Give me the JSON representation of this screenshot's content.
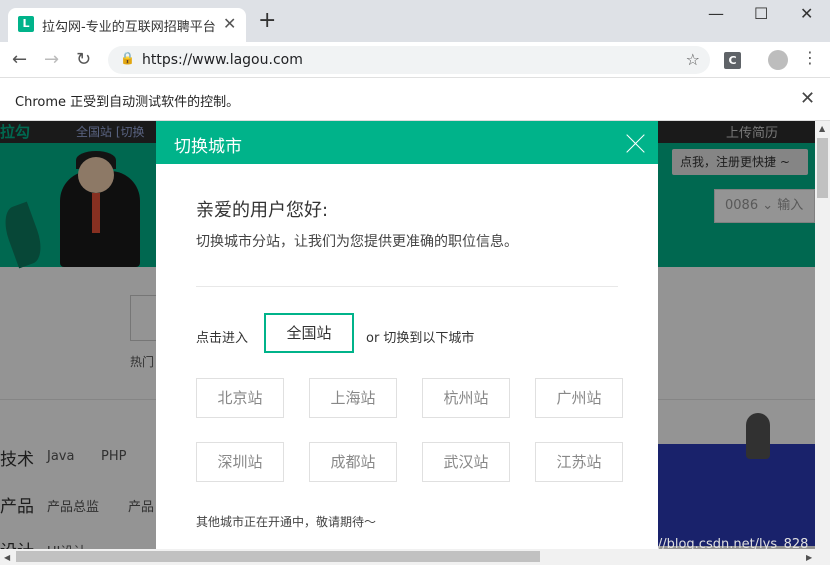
{
  "browser": {
    "tab_title": "拉勾网-专业的互联网招聘平台",
    "favicon_letter": "L",
    "tab_close": "✕",
    "new_tab": "+",
    "minimize": "—",
    "maximize": "☐",
    "close": "✕",
    "url": "https://www.lagou.com",
    "extension_letter": "C",
    "info_message": "Chrome 正受到自动测试软件的控制。",
    "info_close": "✕"
  },
  "background_page": {
    "logo": "拉勾",
    "nav": "全国站   [切换",
    "upload": "上传简历",
    "register_hint": "点我，注册更快捷 ~",
    "phone_prefix": "0086  ⌄  输入",
    "hot_label": "热门",
    "categories": [
      {
        "name": "技术",
        "items": [
          "Java",
          "PHP"
        ]
      },
      {
        "name": "产品",
        "items": [
          "产品总监",
          "产品"
        ]
      },
      {
        "name": "设计",
        "items": [
          "UI设计"
        ]
      }
    ],
    "watermark": "https://blog.csdn.net/lys_828"
  },
  "modal": {
    "title": "切换城市",
    "greeting": "亲爱的用户您好:",
    "subtext": "切换城市分站，让我们为您提供更准确的职位信息。",
    "enter_label": "点击进入",
    "nation_button": "全国站",
    "or_text": "or 切换到以下城市",
    "cities": [
      "北京站",
      "上海站",
      "杭州站",
      "广州站",
      "深圳站",
      "成都站",
      "武汉站",
      "江苏站"
    ],
    "footnote": "其他城市正在开通中，敬请期待～"
  },
  "colors": {
    "accent": "#00b38a",
    "overlay": "rgba(0,0,0,0.42)"
  }
}
